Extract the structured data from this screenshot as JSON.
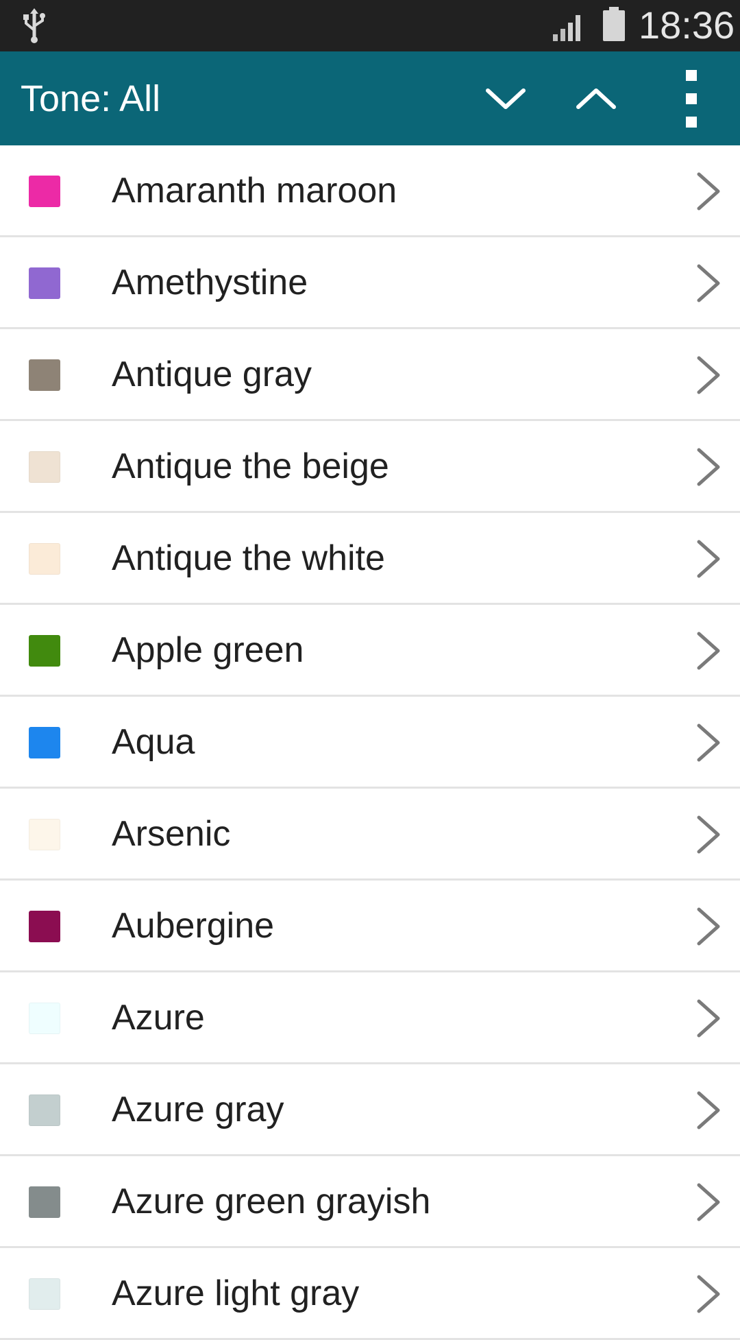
{
  "status_bar": {
    "time": "18:36",
    "icons": [
      "usb-icon",
      "signal-icon",
      "battery-icon"
    ]
  },
  "toolbar": {
    "title": "Tone:  All",
    "background": "#0b6677",
    "actions": [
      "chevron-down-icon",
      "chevron-up-icon",
      "more-vert-icon"
    ]
  },
  "colors": [
    {
      "label": "Amaranth maroon",
      "swatch": "#ec2aa6"
    },
    {
      "label": "Amethystine",
      "swatch": "#9068d1"
    },
    {
      "label": "Antique gray",
      "swatch": "#8e8376"
    },
    {
      "label": "Antique the beige",
      "swatch": "#efe2d3"
    },
    {
      "label": "Antique the white",
      "swatch": "#fbebd8"
    },
    {
      "label": "Apple green",
      "swatch": "#418a0e"
    },
    {
      "label": "Aqua",
      "swatch": "#1d86ee"
    },
    {
      "label": "Arsenic",
      "swatch": "#fdf6ea"
    },
    {
      "label": "Aubergine",
      "swatch": "#8b0d51"
    },
    {
      "label": "Azure",
      "swatch": "#effeff"
    },
    {
      "label": "Azure gray",
      "swatch": "#c3cfcf"
    },
    {
      "label": "Azure green grayish",
      "swatch": "#848c8c"
    },
    {
      "label": "Azure light gray",
      "swatch": "#e1eded"
    }
  ]
}
